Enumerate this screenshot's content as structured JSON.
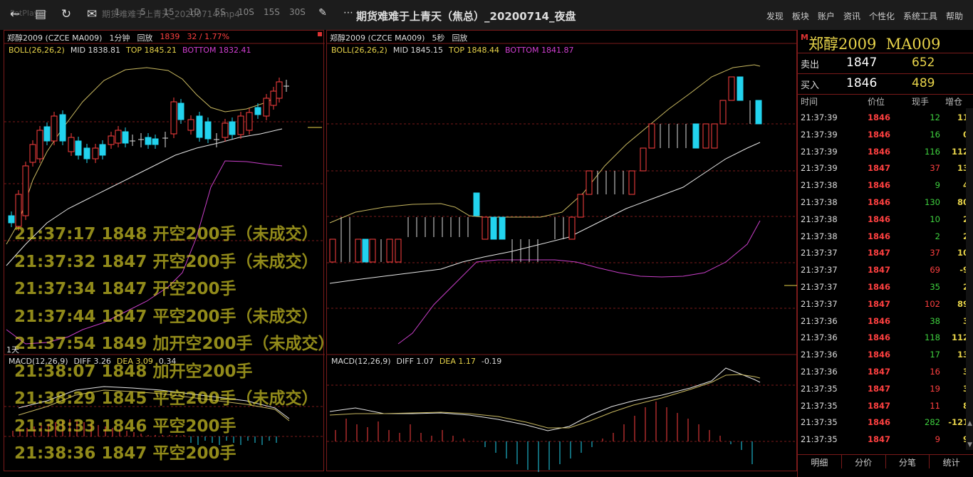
{
  "window": {
    "title": "期货难难于上青天（焦总）_20200714_夜盘",
    "faded_app": "PotPlayer",
    "faded_tab": "期货难难于上青天_20200714.mp4"
  },
  "toolbar": {
    "tools": [
      "←",
      "▤",
      "↻",
      "✉"
    ],
    "periods": [
      "1",
      "5",
      "15",
      "1D",
      "5S",
      "10S",
      "15S",
      "30S"
    ],
    "menu": [
      "发现",
      "板块",
      "账户",
      "资讯",
      "个性化",
      "系统工具",
      "帮助"
    ]
  },
  "left_chart": {
    "symbol": "郑醇2009 (CZCE MA009)",
    "period": "1分钟",
    "replay": "回放",
    "price": "1839",
    "change": "32 / 1.77%",
    "boll_label": "BOLL(26,26,2)",
    "mid": "MID 1838.81",
    "top": "TOP 1845.21",
    "bottom": "BOTTOM 1832.41",
    "day_mark": "1天",
    "macd_label": "MACD(12,26,9)",
    "diff": "DIFF 3.26",
    "dea": "DEA 3.09",
    "macd": "0.34"
  },
  "mid_chart": {
    "symbol": "郑醇2009 (CZCE MA009)",
    "period": "5秒",
    "replay": "回放",
    "boll_label": "BOLL(26,26,2)",
    "mid": "MID 1845.15",
    "top": "TOP 1848.44",
    "bottom": "BOTTOM 1841.87",
    "macd_label": "MACD(12,26,9)",
    "diff": "DIFF 1.07",
    "dea": "DEA 1.17",
    "macd": "-0.19"
  },
  "overlay_lines": [
    "21:37:17 1848 开空200手（未成交）",
    "21:37:32 1847 开空200手（未成交）",
    "21:37:34 1847 开空200手",
    "21:37:44 1847 平空200手（未成交）",
    "21:37:54 1849 加开空200手（未成交）",
    "21:38:07 1848 加开空200手",
    "21:38:29 1845 平空200手（未成交）",
    "21:38:33 1846 平空200手",
    "21:38:36 1847 平空200手"
  ],
  "quote": {
    "name": "郑醇2009",
    "code": "MA009",
    "sell_label": "卖出",
    "sell_price": "1847",
    "sell_vol": "652",
    "buy_label": "买入",
    "buy_price": "1846",
    "buy_vol": "489"
  },
  "ticks_header": [
    "时间",
    "价位",
    "现手",
    "增仓"
  ],
  "ticks": [
    {
      "time": "21:37:39",
      "price": "1846",
      "vol": "12",
      "chg": "11",
      "c": "green"
    },
    {
      "time": "21:37:39",
      "price": "1846",
      "vol": "16",
      "chg": "0",
      "c": "green"
    },
    {
      "time": "21:37:39",
      "price": "1846",
      "vol": "116",
      "chg": "112",
      "c": "green"
    },
    {
      "time": "21:37:39",
      "price": "1847",
      "vol": "37",
      "chg": "13",
      "c": "red"
    },
    {
      "time": "21:37:38",
      "price": "1846",
      "vol": "9",
      "chg": "4",
      "c": "green"
    },
    {
      "time": "21:37:38",
      "price": "1846",
      "vol": "130",
      "chg": "80",
      "c": "green"
    },
    {
      "time": "21:37:38",
      "price": "1846",
      "vol": "10",
      "chg": "2",
      "c": "green"
    },
    {
      "time": "21:37:38",
      "price": "1846",
      "vol": "2",
      "chg": "2",
      "c": "green"
    },
    {
      "time": "21:37:37",
      "price": "1847",
      "vol": "37",
      "chg": "10",
      "c": "red"
    },
    {
      "time": "21:37:37",
      "price": "1847",
      "vol": "69",
      "chg": "-9",
      "c": "red"
    },
    {
      "time": "21:37:37",
      "price": "1846",
      "vol": "35",
      "chg": "2",
      "c": "green"
    },
    {
      "time": "21:37:37",
      "price": "1847",
      "vol": "102",
      "chg": "89",
      "c": "red"
    },
    {
      "time": "21:37:36",
      "price": "1846",
      "vol": "38",
      "chg": "3",
      "c": "green"
    },
    {
      "time": "21:37:36",
      "price": "1846",
      "vol": "118",
      "chg": "112",
      "c": "green"
    },
    {
      "time": "21:37:36",
      "price": "1846",
      "vol": "17",
      "chg": "13",
      "c": "green"
    },
    {
      "time": "21:37:36",
      "price": "1847",
      "vol": "16",
      "chg": "3",
      "c": "red"
    },
    {
      "time": "21:37:35",
      "price": "1847",
      "vol": "19",
      "chg": "3",
      "c": "red"
    },
    {
      "time": "21:37:35",
      "price": "1847",
      "vol": "11",
      "chg": "8",
      "c": "red"
    },
    {
      "time": "21:37:35",
      "price": "1846",
      "vol": "282",
      "chg": "-121",
      "c": "green"
    },
    {
      "time": "21:37:35",
      "price": "1847",
      "vol": "9",
      "chg": "9",
      "c": "red"
    }
  ],
  "tabs": [
    "明细",
    "分价",
    "分笔",
    "统计"
  ],
  "colors": {
    "up": "#ff4040",
    "down": "#22d3ee",
    "boll_top": "#c8b860",
    "boll_mid": "#e6e6e6",
    "boll_bottom": "#c83fc8",
    "border": "#7a1a1a"
  }
}
